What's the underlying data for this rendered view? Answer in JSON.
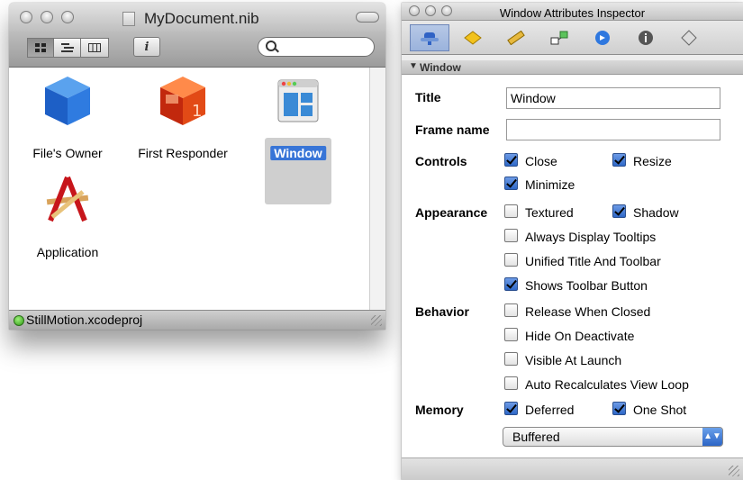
{
  "nib_window": {
    "title": "MyDocument.nib",
    "view_modes": [
      "icon-view",
      "list-view",
      "column-view"
    ],
    "info_label": "i",
    "items": [
      {
        "name": "File's Owner",
        "icon": "blue-cube-icon"
      },
      {
        "name": "First Responder",
        "icon": "red-cube-icon"
      },
      {
        "name": "Window",
        "icon": "window-icon",
        "selected": true
      },
      {
        "name": "Application",
        "icon": "application-icon"
      }
    ],
    "status": "StillMotion.xcodeproj"
  },
  "inspector": {
    "title": "Window Attributes Inspector",
    "section": "Window",
    "title_label": "Title",
    "title_value": "Window",
    "frame_name_label": "Frame name",
    "frame_name_value": "",
    "controls_label": "Controls",
    "close": "Close",
    "resize": "Resize",
    "minimize": "Minimize",
    "appearance_label": "Appearance",
    "textured": "Textured",
    "shadow": "Shadow",
    "tooltips": "Always Display Tooltips",
    "unified": "Unified Title And Toolbar",
    "toolbar_button": "Shows Toolbar Button",
    "behavior_label": "Behavior",
    "release": "Release When Closed",
    "hide": "Hide On Deactivate",
    "visible": "Visible At Launch",
    "auto_recalc": "Auto Recalculates View Loop",
    "memory_label": "Memory",
    "deferred": "Deferred",
    "one_shot": "One Shot",
    "backing": "Buffered",
    "checked": {
      "close": true,
      "resize": true,
      "minimize": true,
      "textured": false,
      "shadow": true,
      "tooltips": false,
      "unified": false,
      "toolbar_button": true,
      "release": false,
      "hide": false,
      "visible": false,
      "auto_recalc": false,
      "deferred": true,
      "one_shot": true
    }
  }
}
